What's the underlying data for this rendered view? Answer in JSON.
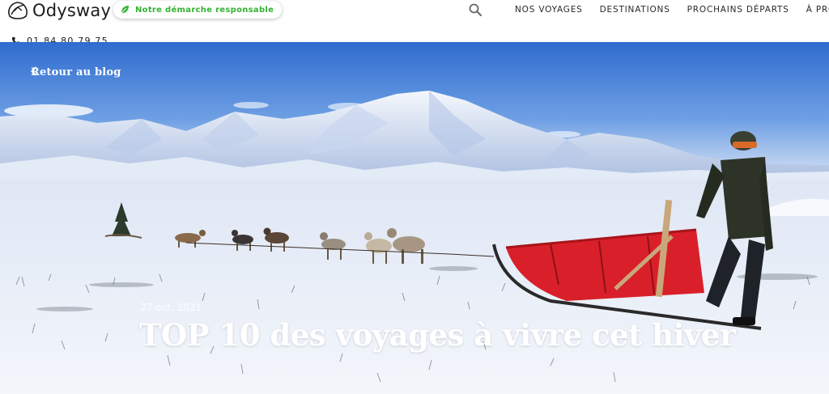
{
  "brand": {
    "name": "Odysway"
  },
  "header": {
    "badge_label": "Notre démarche responsable",
    "phone": "01 84 80 79 75",
    "nav": [
      {
        "label": "NOS VOYAGES"
      },
      {
        "label": "DESTINATIONS"
      },
      {
        "label": "PROCHAINS DÉPARTS"
      },
      {
        "label": "À PROPOS"
      }
    ]
  },
  "hero": {
    "back_label": "Retour au blog",
    "date": "27 oct. 2021",
    "title": "TOP 10 des voyages à vivre cet hiver"
  },
  "colors": {
    "accent_green": "#34b233",
    "sky": "#3d78d4",
    "snow": "#eef2fa",
    "sled_red": "#d9202a"
  },
  "icons": {
    "logo": "odysway-logo-icon",
    "badge": "leaf-icon",
    "phone": "phone-icon",
    "search": "search-icon",
    "back": "chevron-left-icon"
  }
}
